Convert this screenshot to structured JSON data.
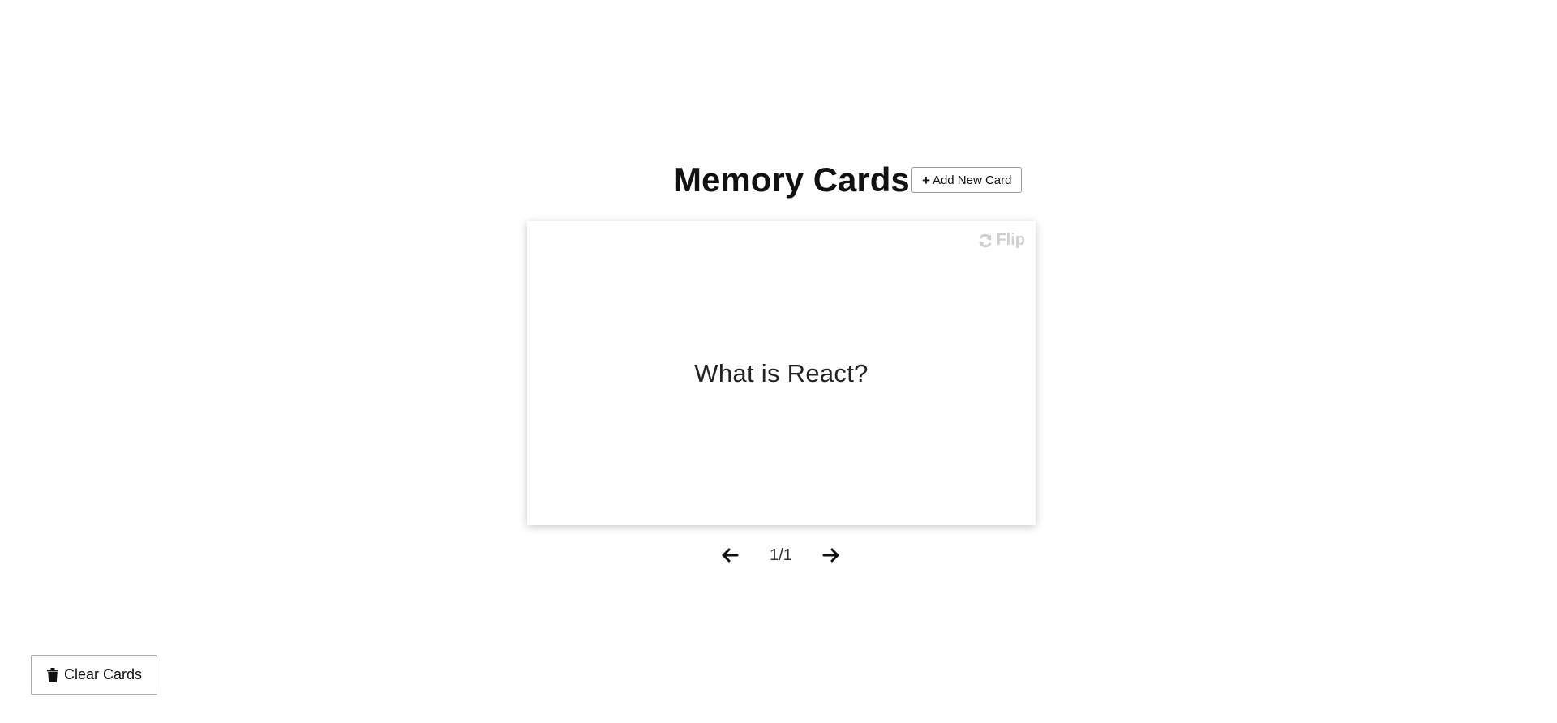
{
  "header": {
    "title": "Memory Cards",
    "add_button_icon": "plus-icon",
    "add_button_symbol": "+",
    "add_button_label": "Add New Card"
  },
  "card": {
    "flip_icon": "refresh-icon",
    "flip_label": "Flip",
    "text": "What is React?"
  },
  "navigation": {
    "prev_icon": "arrow-left-icon",
    "next_icon": "arrow-right-icon",
    "counter": "1/1"
  },
  "footer": {
    "clear_icon": "trash-icon",
    "clear_label": "Clear Cards"
  },
  "colors": {
    "background": "#ffffff",
    "text": "#111111",
    "flip_muted": "#cfcfcf",
    "button_border": "#999999"
  }
}
